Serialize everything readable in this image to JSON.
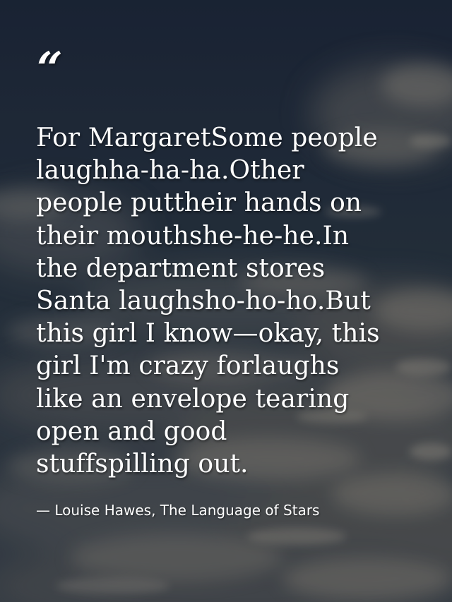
{
  "quote": {
    "mark": "“",
    "lines": [
      "For MargaretSome people",
      "laughha-ha-ha.Other",
      "people puttheir hands on",
      "their mouthshe-he-he.In",
      "the department stores",
      "Santa laughsho-ho-ho.But",
      "this girl I know—okay, this",
      "girl I'm crazy forlaughs",
      "like an envelope tearing",
      "open and good",
      "stuffspilling out."
    ],
    "attribution": "— Louise Hawes, The Language of Stars"
  },
  "colors": {
    "text": "#ffffff",
    "sky_top": "#1c2638",
    "sky_bottom": "#3d4650",
    "cloud": "#8f8a80"
  }
}
